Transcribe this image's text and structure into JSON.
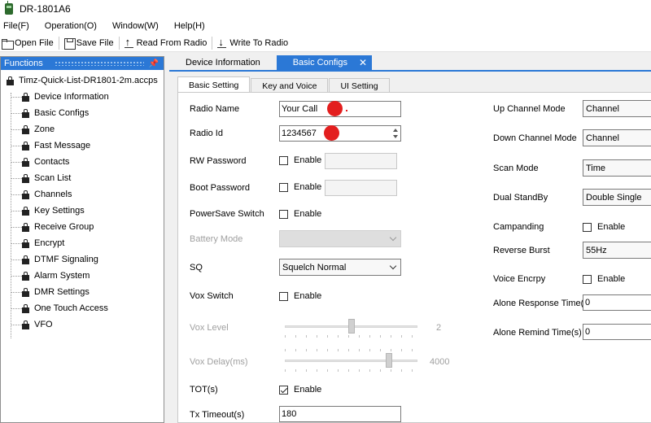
{
  "window": {
    "title": "DR-1801A6"
  },
  "menu": [
    "File(F)",
    "Operation(O)",
    "Window(W)",
    "Help(H)"
  ],
  "toolbar": {
    "open": "Open File",
    "save": "Save File",
    "read": "Read From Radio",
    "write": "Write To Radio"
  },
  "functions": {
    "title": "Functions",
    "pin": "ᵖ",
    "root": "Timz-Quick-List-DR1801-2m.accps",
    "items": [
      "Device Information",
      "Basic Configs",
      "Zone",
      "Fast Message",
      "Contacts",
      "Scan List",
      "Channels",
      "Key Settings",
      "Receive Group",
      "Encrypt",
      "DTMF Signaling",
      "Alarm System",
      "DMR Settings",
      "One Touch Access",
      "VFO"
    ]
  },
  "doc_tabs": {
    "tab1": "Device Information",
    "tab2": "Basic Configs",
    "close": "✕"
  },
  "sub_tabs": [
    "Basic Setting",
    "Key and Voice",
    "UI Setting"
  ],
  "form": {
    "radio_name": {
      "label": "Radio Name",
      "value": "Your Call"
    },
    "radio_id": {
      "label": "Radio Id",
      "value": "1234567"
    },
    "rw_password": {
      "label": "RW Password",
      "check": "Enable",
      "checked": false
    },
    "boot_password": {
      "label": "Boot Password",
      "check": "Enable",
      "checked": false
    },
    "powersave": {
      "label": "PowerSave Switch",
      "check": "Enable",
      "checked": false
    },
    "battery_mode": {
      "label": "Battery Mode",
      "value": ""
    },
    "sq": {
      "label": "SQ",
      "value": "Squelch Normal"
    },
    "vox_switch": {
      "label": "Vox Switch",
      "check": "Enable",
      "checked": false
    },
    "vox_level": {
      "label": "Vox Level",
      "value": "2",
      "fraction": 0.5
    },
    "vox_delay": {
      "label": "Vox Delay(ms)",
      "value": "4000",
      "fraction": 0.8
    },
    "tot": {
      "label": "TOT(s)",
      "check": "Enable",
      "checked": true
    },
    "tx_timeout": {
      "label": "Tx Timeout(s)",
      "value": "180"
    }
  },
  "right": {
    "up_channel_mode": {
      "label": "Up Channel Mode",
      "value": "Channel"
    },
    "down_channel_mode": {
      "label": "Down Channel Mode",
      "value": "Channel"
    },
    "scan_mode": {
      "label": "Scan Mode",
      "value": "Time"
    },
    "dual_standby": {
      "label": "Dual StandBy",
      "value": "Double Single"
    },
    "campanding": {
      "label": "Campanding",
      "check": "Enable",
      "checked": false
    },
    "reverse_burst": {
      "label": "Reverse Burst",
      "value": "55Hz"
    },
    "voice_encrypt": {
      "label": "Voice Encrpy",
      "check": "Enable",
      "checked": false
    },
    "alone_response": {
      "label": "Alone Response Time(r",
      "value": "0"
    },
    "alone_remind": {
      "label": "Alone Remind Time(s)",
      "value": "0"
    }
  },
  "colors": {
    "accent": "#2b78d6",
    "annotation": "#e31e1e"
  }
}
